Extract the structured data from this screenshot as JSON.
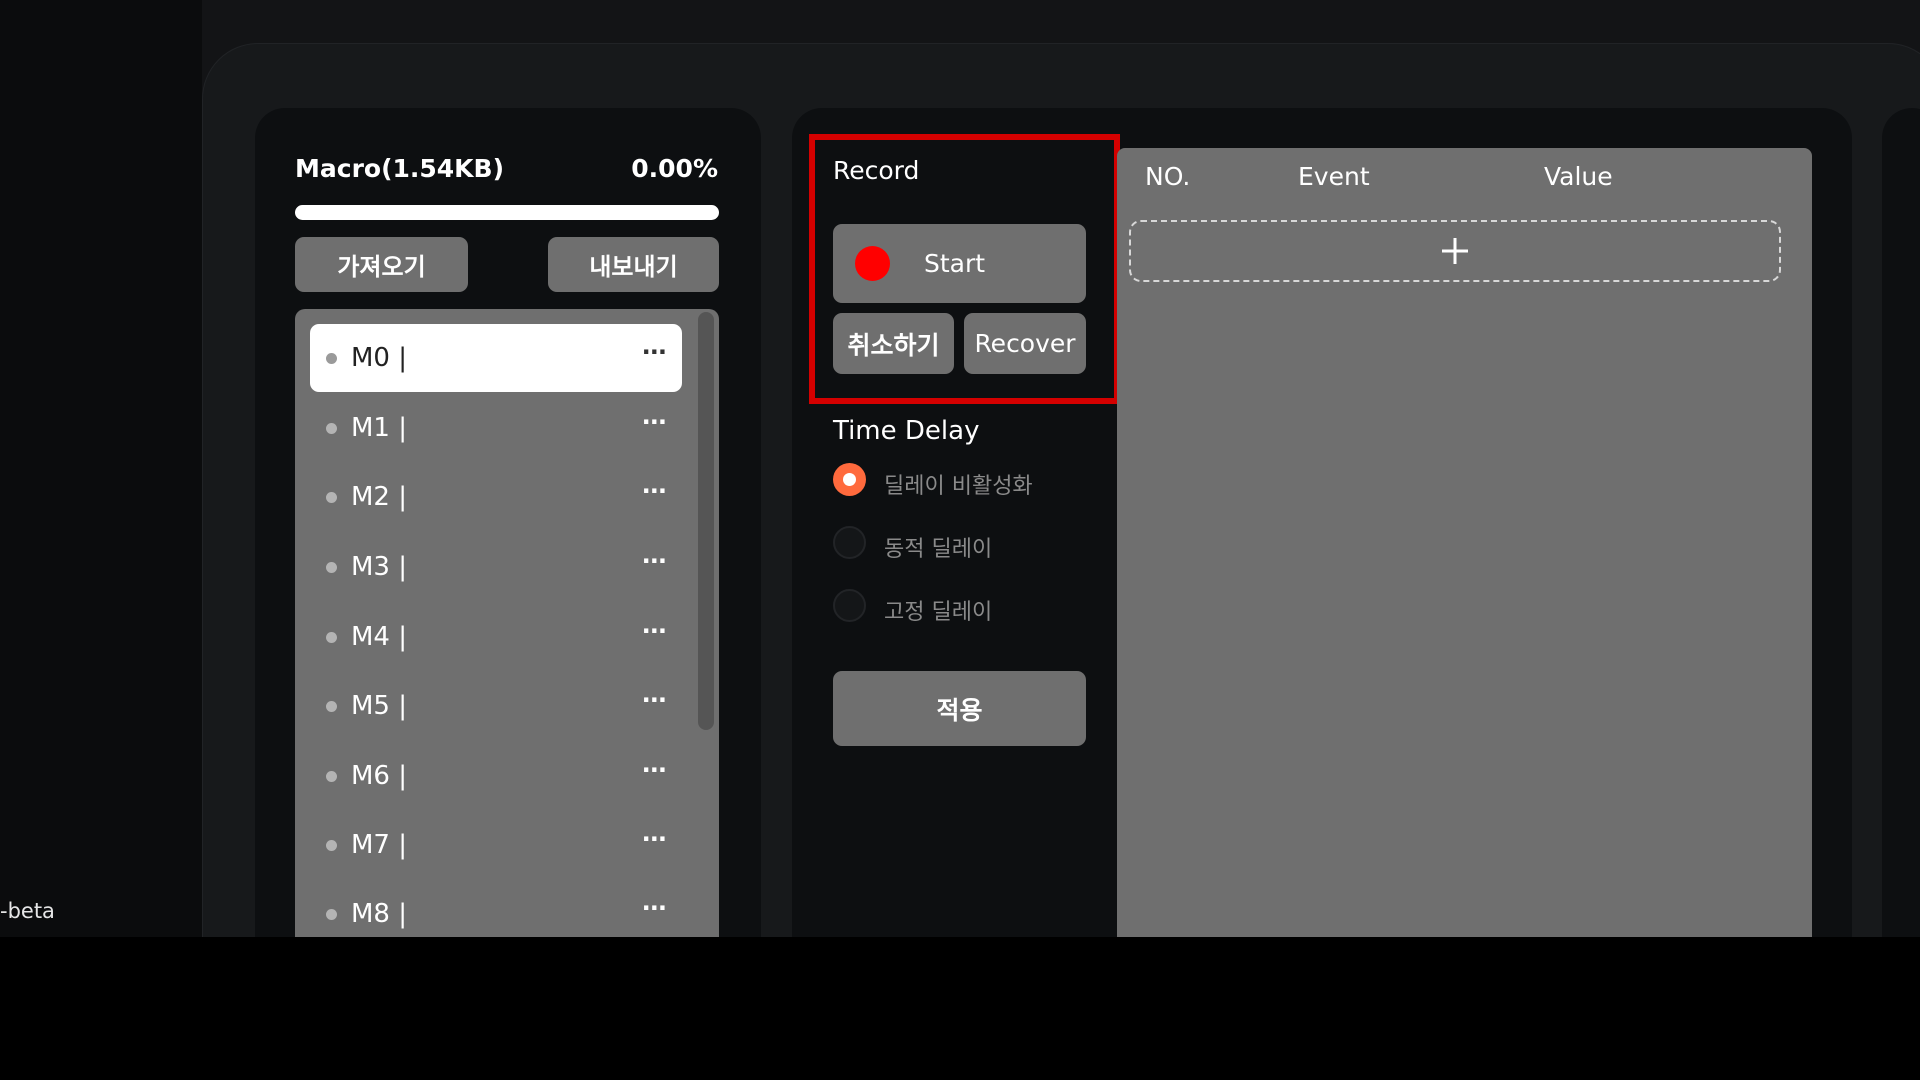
{
  "version_text": "-beta",
  "macro": {
    "title": "Macro(1.54KB)",
    "percent_text": "0.00%",
    "progress_fraction": 0.0,
    "import_label": "가져오기",
    "export_label": "내보내기",
    "items": [
      "M0 |",
      "M1 |",
      "M2 |",
      "M3 |",
      "M4 |",
      "M5 |",
      "M6 |",
      "M7 |",
      "M8 |"
    ],
    "selected_index": 0,
    "more_label": "···"
  },
  "record": {
    "title": "Record",
    "start_label": "Start",
    "cancel_label": "취소하기",
    "recover_label": "Recover"
  },
  "time_delay": {
    "title": "Time Delay",
    "options": [
      "딜레이 비활성화",
      "동적 딜레이",
      "고정 딜레이"
    ],
    "selected_index": 0,
    "apply_label": "적용"
  },
  "event_table": {
    "headers": [
      "NO.",
      "Event",
      "Value"
    ],
    "add_icon": "plus-icon"
  },
  "colors": {
    "accent_radio": "#ff6a3d",
    "record_dot": "#ff0000",
    "highlight_border": "#d40000"
  }
}
